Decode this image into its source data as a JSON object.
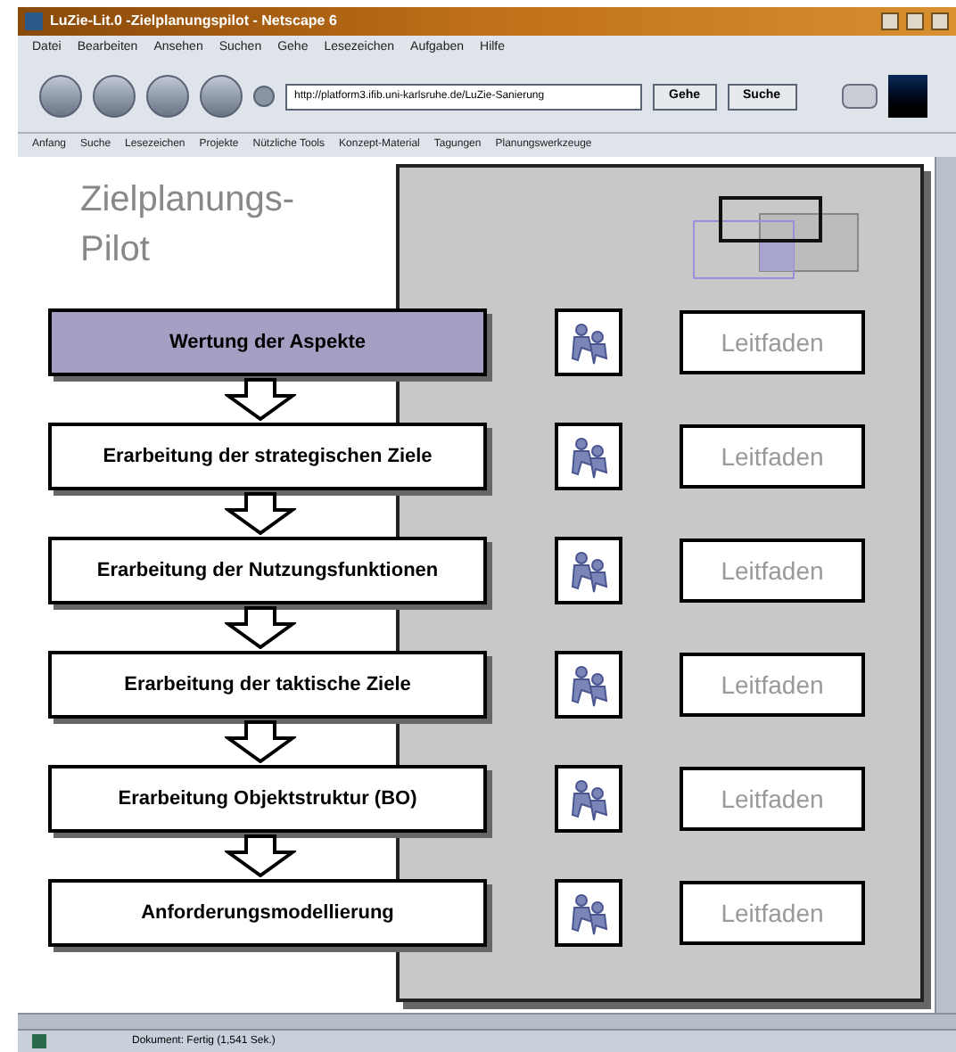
{
  "window": {
    "title": "LuZie-Lit.0 -Zielplanungspilot - Netscape 6"
  },
  "menu": [
    "Datei",
    "Bearbeiten",
    "Ansehen",
    "Suchen",
    "Gehe",
    "Lesezeichen",
    "Aufgaben",
    "Hilfe"
  ],
  "address": {
    "value": "http://platform3.ifib.uni-karlsruhe.de/LuZie-Sanierung"
  },
  "nav_buttons": [
    "Gehe",
    "Suche"
  ],
  "bookmarks": [
    "Anfang",
    "Suche",
    "Lesezeichen",
    "Projekte",
    "Nützliche Tools",
    "Konzept-Material",
    "Tagungen",
    "Planungswerkzeuge"
  ],
  "page": {
    "title": "Zielplanungs-\nPilot",
    "steps": [
      {
        "label": "Wertung der Aspekte",
        "selected": true,
        "guide": "Leitfaden"
      },
      {
        "label": "Erarbeitung der strategischen Ziele",
        "selected": false,
        "guide": "Leitfaden"
      },
      {
        "label": "Erarbeitung der Nutzungsfunktionen",
        "selected": false,
        "guide": "Leitfaden"
      },
      {
        "label": "Erarbeitung der taktische Ziele",
        "selected": false,
        "guide": "Leitfaden"
      },
      {
        "label": "Erarbeitung Objektstruktur (BO)",
        "selected": false,
        "guide": "Leitfaden"
      },
      {
        "label": "Anforderungsmodellierung",
        "selected": false,
        "guide": "Leitfaden"
      }
    ]
  },
  "status_bar": {
    "text": "Dokument: Fertig (1,541 Sek.)"
  }
}
